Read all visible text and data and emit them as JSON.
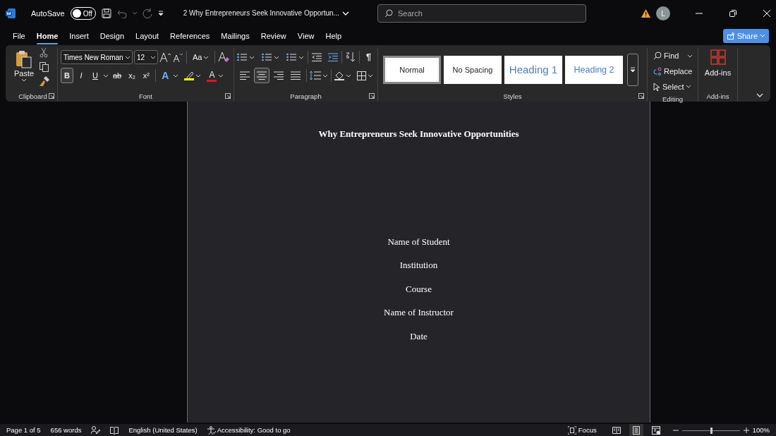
{
  "title_bar": {
    "autosave": {
      "label": "AutoSave",
      "on": false,
      "state_text": "Off"
    },
    "document_title": "2 Why Entrepreneurs Seek Innovative Opportun...",
    "search": {
      "placeholder": "Search"
    },
    "avatar": "L"
  },
  "menu_tabs": [
    {
      "label": "File",
      "selected": false
    },
    {
      "label": "Home",
      "selected": true
    },
    {
      "label": "Insert",
      "selected": false
    },
    {
      "label": "Design",
      "selected": false
    },
    {
      "label": "Layout",
      "selected": false
    },
    {
      "label": "References",
      "selected": false
    },
    {
      "label": "Mailings",
      "selected": false
    },
    {
      "label": "Review",
      "selected": false
    },
    {
      "label": "View",
      "selected": false
    },
    {
      "label": "Help",
      "selected": false
    }
  ],
  "share": "Share",
  "ribbon": {
    "clipboard": {
      "paste": "Paste",
      "label": "Clipboard"
    },
    "font": {
      "font_name": "Times New Roman",
      "font_size": "12",
      "change_case": "Aa",
      "label": "Font",
      "toggles": [
        {
          "kind": "bold",
          "text": "B",
          "selected": true
        },
        {
          "kind": "italic",
          "text": "I",
          "selected": false
        },
        {
          "kind": "underline",
          "text": "U",
          "selected": false
        },
        {
          "kind": "strike",
          "text": "ab",
          "selected": false
        },
        {
          "kind": "sub",
          "text": "x₂",
          "selected": false
        },
        {
          "kind": "sup",
          "text": "x²",
          "selected": false
        }
      ],
      "effects": "A",
      "font_color_text": "A"
    },
    "paragraph": {
      "label": "Paragraph",
      "pilcrow": "¶",
      "alignments": [
        {
          "kind": "left",
          "selected": false
        },
        {
          "kind": "center",
          "selected": true
        },
        {
          "kind": "right",
          "selected": false
        },
        {
          "kind": "justify",
          "selected": false
        }
      ]
    },
    "styles": {
      "label": "Styles",
      "items": [
        {
          "name": "Normal",
          "kind": "normal",
          "selected": true
        },
        {
          "name": "No Spacing",
          "kind": "normal",
          "selected": false
        },
        {
          "name": "Heading 1",
          "kind": "heading1",
          "selected": false
        },
        {
          "name": "Heading 2",
          "kind": "heading2",
          "selected": false
        }
      ]
    },
    "editing": {
      "label": "Editing",
      "find": "Find",
      "replace": "Replace",
      "select": "Select"
    },
    "addins": {
      "button": "Add-ins",
      "label": "Add-ins"
    }
  },
  "document": {
    "title": "Why Entrepreneurs Seek Innovative Opportunities",
    "lines": [
      "Name of Student",
      "Institution",
      "Course",
      "Name of Instructor",
      "Date"
    ]
  },
  "status_bar": {
    "page": "Page 1 of 5",
    "words": "656 words",
    "language": "English (United States)",
    "accessibility": "Accessibility: Good to go",
    "focus": "Focus",
    "views": [
      {
        "kind": "read",
        "selected": false
      },
      {
        "kind": "print",
        "selected": true
      },
      {
        "kind": "web",
        "selected": false
      }
    ],
    "zoom": {
      "level": 0.51,
      "reading": "100%"
    }
  }
}
